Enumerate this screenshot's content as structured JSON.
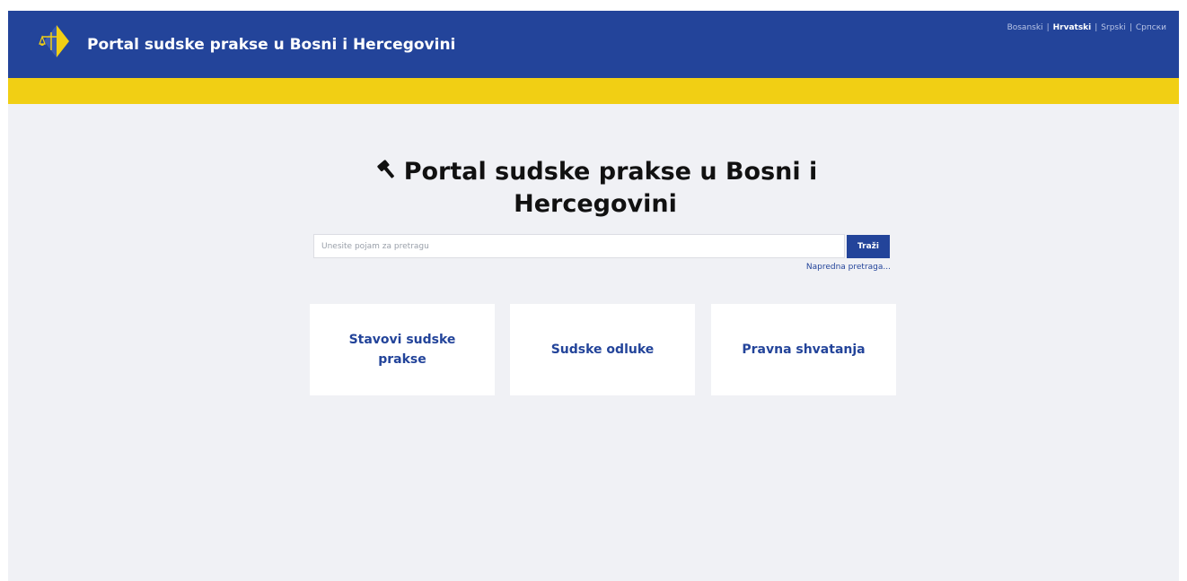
{
  "header": {
    "site_title": "Portal sudske prakse u Bosni i Hercegovini",
    "languages": [
      {
        "label": "Bosanski",
        "active": false
      },
      {
        "label": "Hrvatski",
        "active": true
      },
      {
        "label": "Srpski",
        "active": false
      },
      {
        "label": "Српски",
        "active": false
      }
    ],
    "separator": "|"
  },
  "hero": {
    "title": "Portal sudske prakse u Bosni i Hercegovini"
  },
  "search": {
    "placeholder": "Unesite pojam za pretragu",
    "button_label": "Traži",
    "advanced_link": "Napredna pretraga..."
  },
  "cards": [
    {
      "label": "Stavovi sudske prakse"
    },
    {
      "label": "Sudske odluke"
    },
    {
      "label": "Pravna shvatanja"
    }
  ],
  "colors": {
    "header_bg": "#23449a",
    "band": "#f1cf14",
    "page_bg": "#f0f1f5",
    "accent": "#23449a"
  },
  "icons": {
    "logo": "scales-of-justice-logo",
    "title": "gavel-icon"
  }
}
